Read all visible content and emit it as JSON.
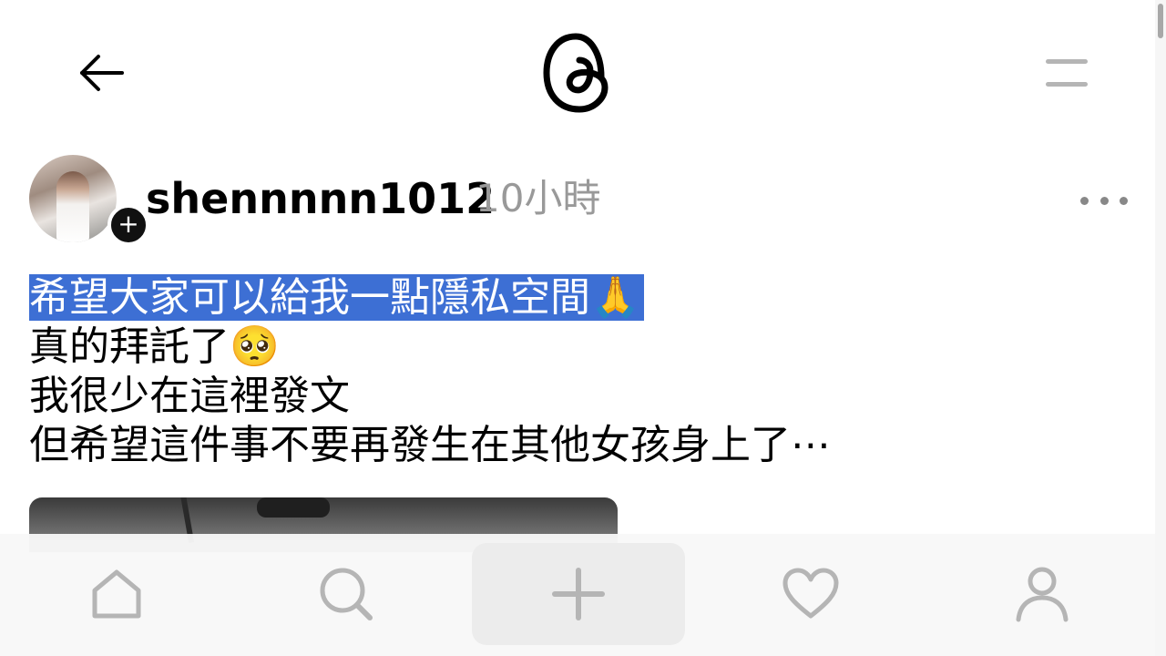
{
  "header": {
    "back_icon": "arrow-left-icon",
    "logo_icon": "threads-logo",
    "menu_icon": "menu-icon"
  },
  "post": {
    "username": "shennnnn1012",
    "timestamp": "10小時",
    "avatar_badge": "+",
    "more_icon": "ellipsis-icon",
    "lines": [
      {
        "text": "希望大家可以給我一點隱私空間🙏",
        "highlighted": true
      },
      {
        "text": "真的拜託了🥺",
        "highlighted": false
      },
      {
        "text": "我很少在這裡發文",
        "highlighted": false
      },
      {
        "text": "但希望這件事不要再發生在其他女孩身上了⋯",
        "highlighted": false
      }
    ]
  },
  "bottom_nav": {
    "items": [
      {
        "name": "home",
        "icon": "home-icon"
      },
      {
        "name": "search",
        "icon": "search-icon"
      },
      {
        "name": "create",
        "icon": "plus-icon"
      },
      {
        "name": "activity",
        "icon": "heart-icon"
      },
      {
        "name": "profile",
        "icon": "user-icon"
      }
    ]
  },
  "colors": {
    "highlight": "#3d6fd4",
    "muted_icon": "#b5b5b5",
    "timestamp": "#999999",
    "create_bg": "#ececec"
  }
}
